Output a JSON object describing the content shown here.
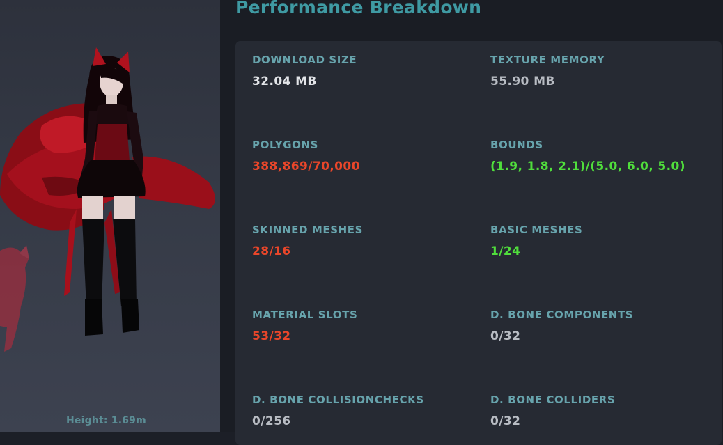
{
  "title": "Performance Breakdown",
  "avatar": {
    "height_label": "Height: 1.69m"
  },
  "colors": {
    "ok": "#50de3c",
    "bad": "#e9462a",
    "neutral": "#b8bcc3",
    "primary": "#e2e4e8",
    "label": "#67a3ac",
    "title": "#3f9aa3"
  },
  "stats": [
    {
      "label": "DOWNLOAD SIZE",
      "value": "32.04 MB",
      "status": "primary"
    },
    {
      "label": "TEXTURE MEMORY",
      "value": "55.90 MB",
      "status": "neutral"
    },
    {
      "label": "POLYGONS",
      "value": "388,869/70,000",
      "status": "bad"
    },
    {
      "label": "BOUNDS",
      "value": "(1.9, 1.8, 2.1)/(5.0, 6.0, 5.0)",
      "status": "ok"
    },
    {
      "label": "SKINNED MESHES",
      "value": "28/16",
      "status": "bad"
    },
    {
      "label": "BASIC MESHES",
      "value": "1/24",
      "status": "ok"
    },
    {
      "label": "MATERIAL SLOTS",
      "value": "53/32",
      "status": "bad"
    },
    {
      "label": "D. BONE COMPONENTS",
      "value": "0/32",
      "status": "neutral"
    },
    {
      "label": "D. BONE COLLISIONCHECKS",
      "value": "0/256",
      "status": "neutral"
    },
    {
      "label": "D. BONE COLLIDERS",
      "value": "0/32",
      "status": "neutral"
    }
  ]
}
